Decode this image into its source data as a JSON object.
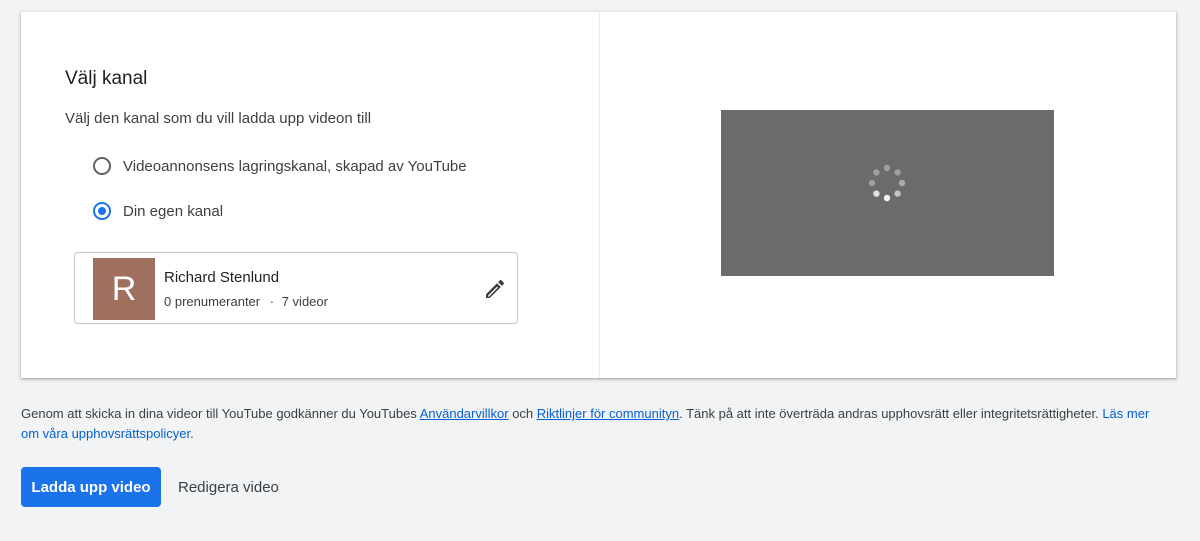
{
  "card": {
    "title": "Välj kanal",
    "subtitle": "Välj den kanal som du vill ladda upp videon till",
    "options": [
      {
        "label": "Videoannonsens lagringskanal, skapad av YouTube",
        "selected": false
      },
      {
        "label": "Din egen kanal",
        "selected": true
      }
    ],
    "channel": {
      "avatar_letter": "R",
      "avatar_color": "#a0705f",
      "name": "Richard Stenlund",
      "subscribers": "0 prenumeranter",
      "separator": "·",
      "videos": "7 videor"
    },
    "preview": {
      "state": "loading",
      "background": "#6b6b6b"
    }
  },
  "terms": {
    "part1": "Genom att skicka in dina videor till YouTube godkänner du YouTubes ",
    "link_terms": "Användarvillkor",
    "part2": " och ",
    "link_guidelines": "Riktlinjer för communityn",
    "part3": ". Tänk på att inte överträda andras upphovsrätt eller integritetsrättigheter. ",
    "link_copyright": "Läs mer om våra upphovsrättspolicyer",
    "part4": "."
  },
  "actions": {
    "upload_label": "Ladda upp video",
    "edit_label": "Redigera video"
  },
  "colors": {
    "accent": "#1a73e8",
    "link": "#065fd4",
    "page_bg": "#f1f3f4"
  }
}
